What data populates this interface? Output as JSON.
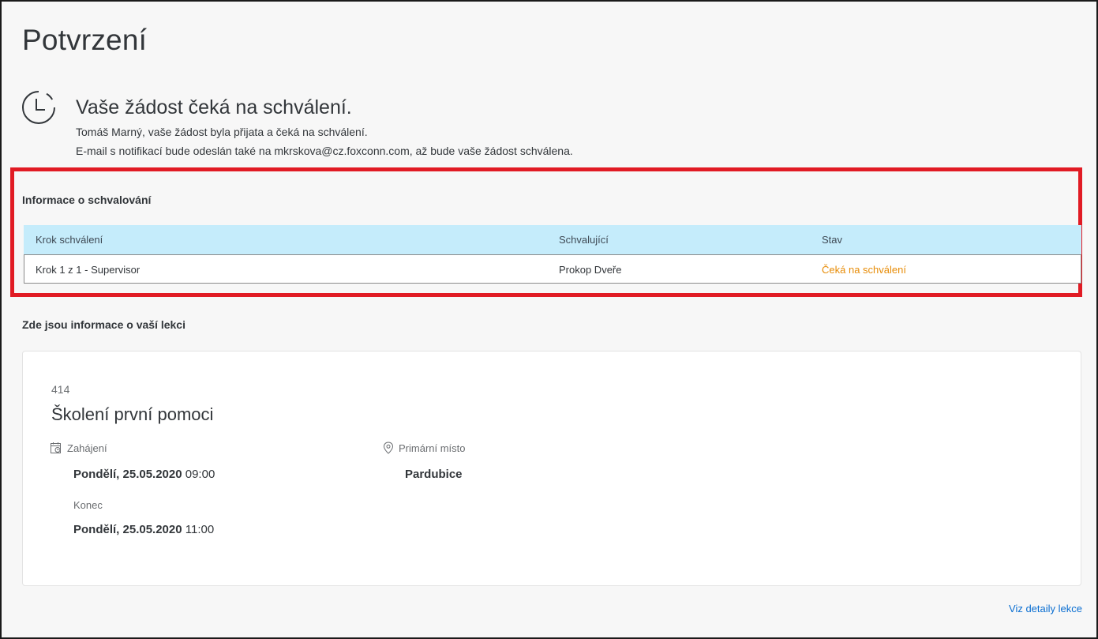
{
  "page": {
    "title": "Potvrzení"
  },
  "status": {
    "icon": "clock-icon",
    "heading": "Vaše žádost čeká na schválení.",
    "line1": "Tomáš Marný, vaše žádost byla přijata a čeká na schválení.",
    "line2": "E-mail s notifikací bude odeslán také na mkrskova@cz.foxconn.com, až bude vaše žádost schválena."
  },
  "approval": {
    "section_label": "Informace o schvalování",
    "columns": [
      "Krok schválení",
      "Schvalující",
      "Stav"
    ],
    "rows": [
      {
        "step": "Krok 1 z 1 - Supervisor",
        "approver": "Prokop Dveře",
        "status": "Čeká na schválení"
      }
    ],
    "status_color": "#e78c07",
    "header_color": "#c5ecfb",
    "highlight_color": "#e11b24"
  },
  "lesson": {
    "section_label": "Zde jsou informace o vaší lekci",
    "code": "414",
    "name": "Školení první pomoci",
    "start_label": "Zahájení",
    "start_date": "Pondělí, 25.05.2020",
    "start_time": "09:00",
    "end_label": "Konec",
    "end_date": "Pondělí, 25.05.2020",
    "end_time": "11:00",
    "place_label": "Primární místo",
    "place_value": "Pardubice",
    "start_icon": "calendar-icon",
    "place_icon": "location-pin-icon"
  },
  "footer": {
    "detail_link": "Viz detaily lekce",
    "link_color": "#0a6ed1"
  }
}
